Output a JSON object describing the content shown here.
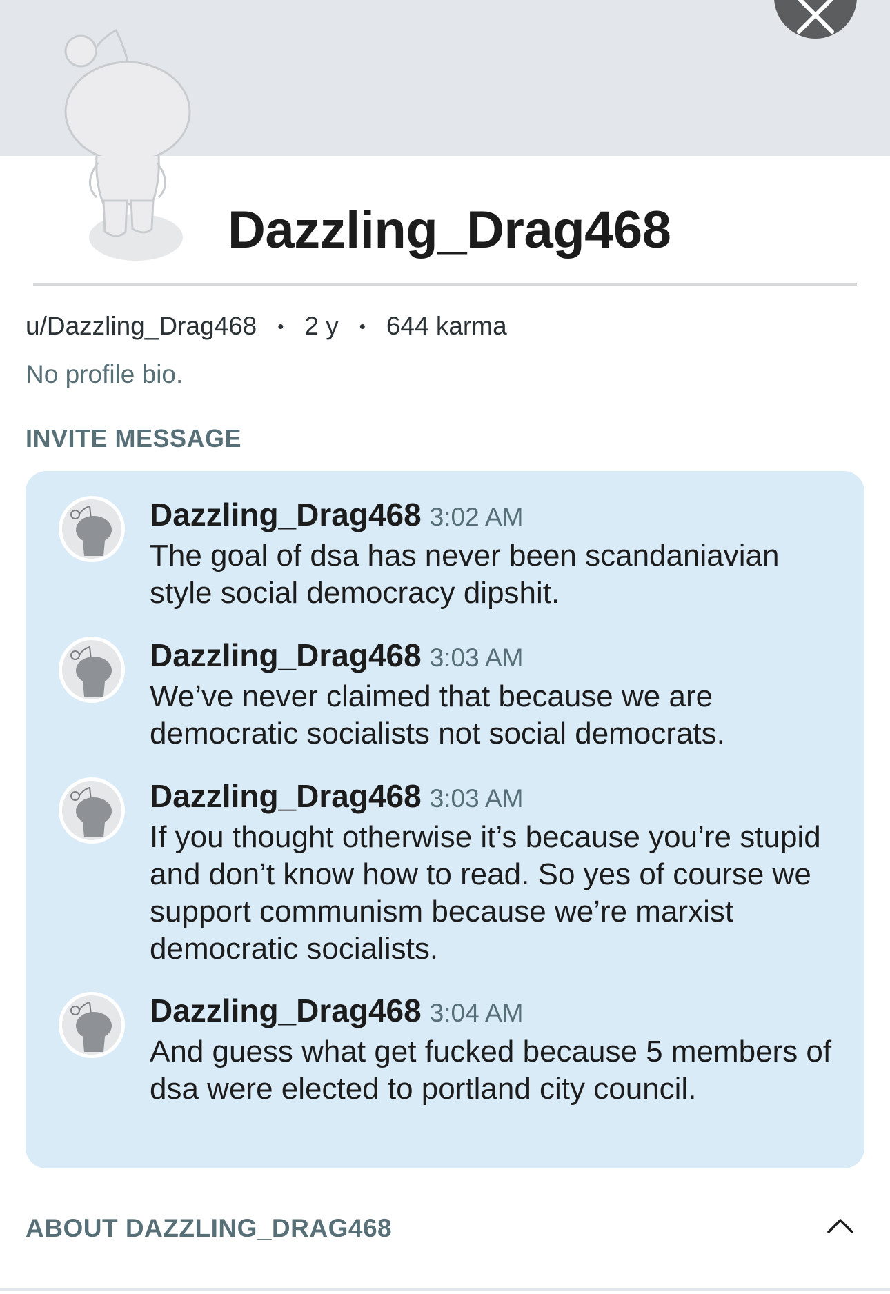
{
  "profile": {
    "display_name": "Dazzling_Drag468",
    "handle": "u/Dazzling_Drag468",
    "account_age": "2 y",
    "karma": "644 karma",
    "separator": "•",
    "bio": "No profile bio."
  },
  "invite": {
    "section_label": "INVITE MESSAGE",
    "messages": [
      {
        "author": "Dazzling_Drag468",
        "time": "3:02 AM",
        "text": "The goal of dsa has never been scandaniavian style social democracy dipshit."
      },
      {
        "author": "Dazzling_Drag468",
        "time": "3:03 AM",
        "text": "We’ve never claimed that because we are democratic socialists not social democrats."
      },
      {
        "author": "Dazzling_Drag468",
        "time": "3:03 AM",
        "text": "If you thought otherwise it’s because you’re stupid and don’t know how to read. So yes of course we support communism because we’re marxist democratic socialists."
      },
      {
        "author": "Dazzling_Drag468",
        "time": "3:04 AM",
        "text": "And guess what get fucked because 5 members of dsa were elected to portland city council."
      }
    ]
  },
  "about": {
    "label": "ABOUT DAZZLING_DRAG468"
  },
  "icons": {
    "close": "close-icon",
    "avatar": "snoo-avatar-icon",
    "chevron": "chevron-up-icon"
  },
  "colors": {
    "banner": "#e3e6ea",
    "message_card": "#daebf8",
    "muted_text": "#576f76",
    "close_button": "#5b5d5e"
  }
}
